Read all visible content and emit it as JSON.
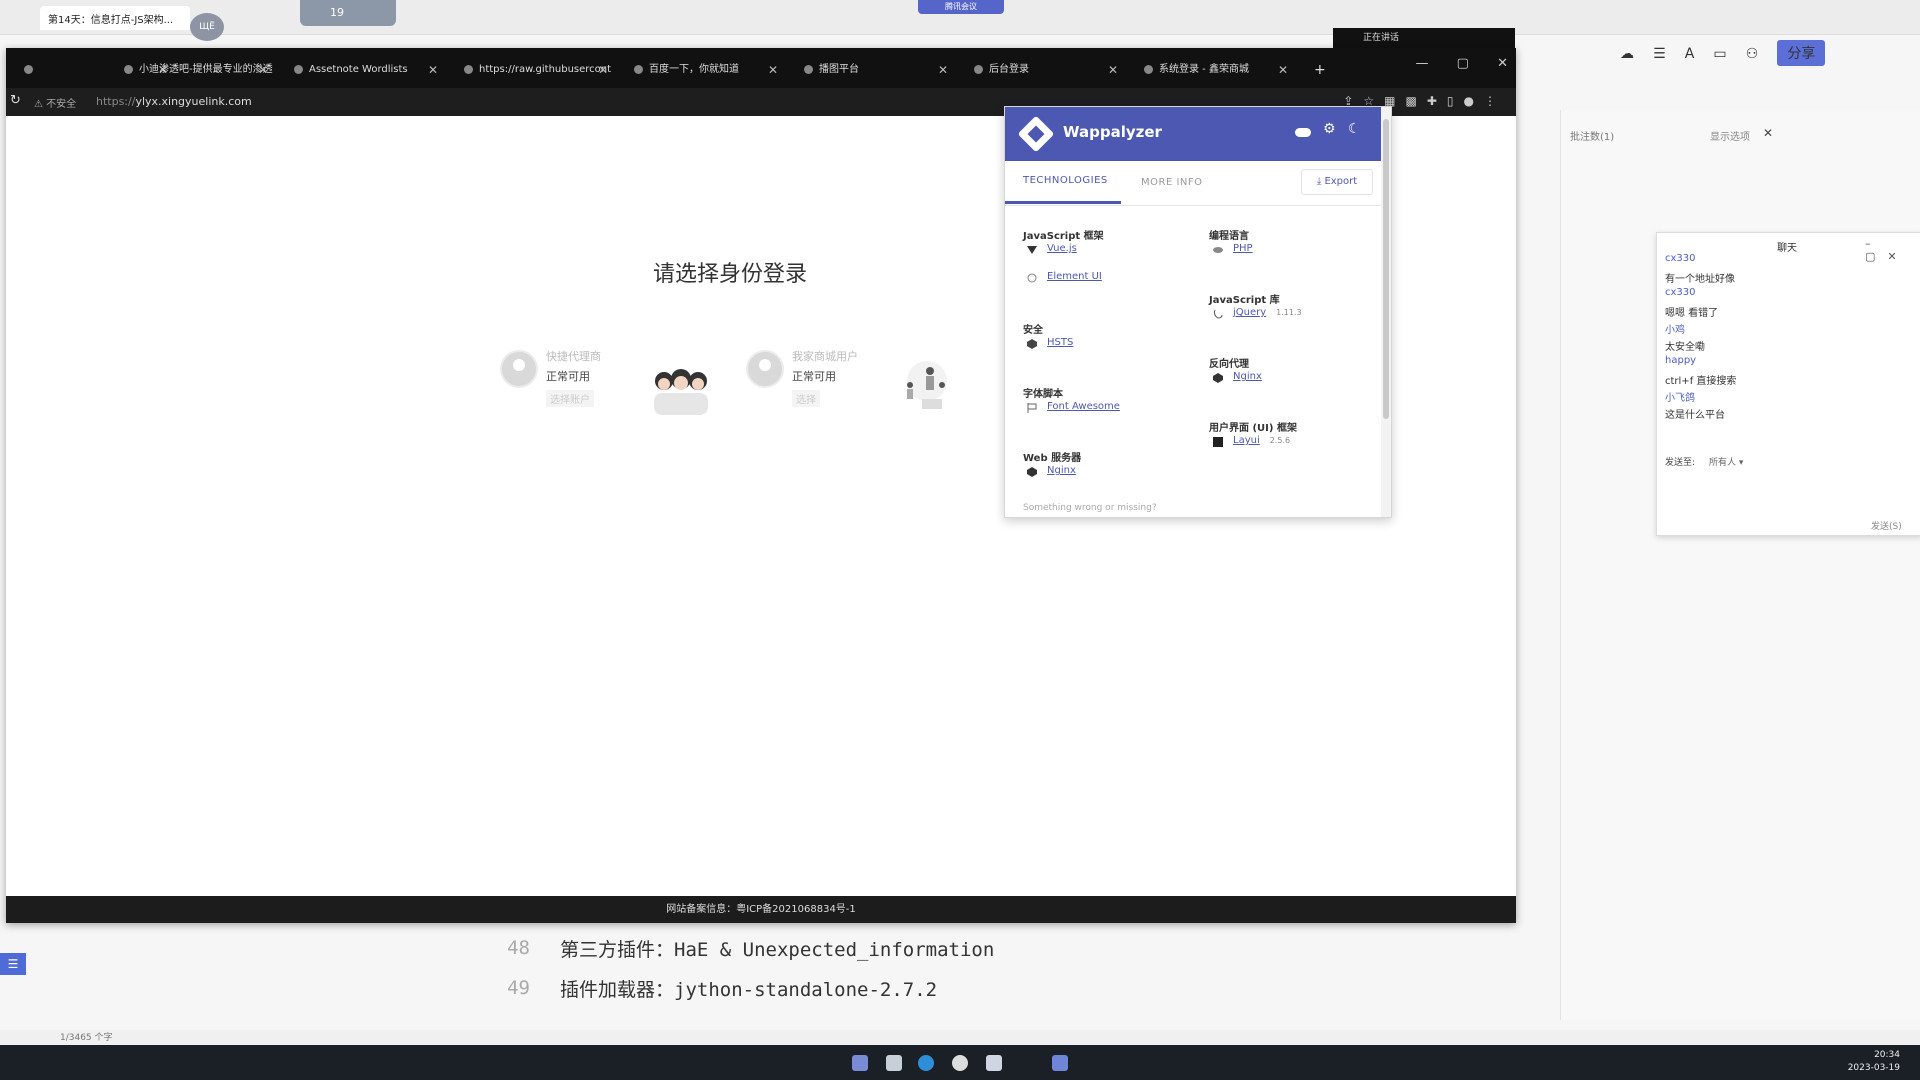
{
  "meeting": {
    "bar_label": "腾讯会议",
    "speaking_label": "正在讲话",
    "video_thumb": "19"
  },
  "editor": {
    "tab_title": "第14天：信息打点-JS架构...",
    "share_label": "分享",
    "lines": [
      {
        "no": "48",
        "text": "第三方插件：HaE & Unexpected_information"
      },
      {
        "no": "49",
        "text": "插件加载器：jython-standalone-2.7.2"
      }
    ],
    "status_text": "1/3465 个字"
  },
  "browser": {
    "tabs": [
      {
        "label": ""
      },
      {
        "label": "小迪渗透吧-提供最专业的渗透"
      },
      {
        "label": "Assetnote Wordlists"
      },
      {
        "label": "https://raw.githubusercont"
      },
      {
        "label": "百度一下，你就知道"
      },
      {
        "label": "播图平台"
      },
      {
        "label": "后台登录"
      },
      {
        "label": "系统登录 - 鑫荣商城"
      }
    ],
    "new_tab": "+",
    "insecure_label": "不安全",
    "url_scheme": "https://",
    "url_host": "ylyx.xingyuelink.com"
  },
  "page": {
    "title": "请选择身份登录",
    "roles": [
      {
        "name": "快捷代理商",
        "status": "正常可用",
        "hint": "选择账户"
      },
      {
        "name": "我家商城用户",
        "status": "正常可用",
        "hint": "选择"
      }
    ],
    "footer": "网站备案信息：粤ICP备2021068834号-1"
  },
  "wappalyzer": {
    "title": "Wappalyzer",
    "tabs": {
      "technologies": "TECHNOLOGIES",
      "more_info": "MORE INFO"
    },
    "export": "Export",
    "left_col": [
      {
        "category": "JavaScript 框架",
        "items": [
          {
            "name": "Vue.js",
            "version": ""
          },
          {
            "name": "Element UI",
            "version": ""
          }
        ]
      },
      {
        "category": "安全",
        "items": [
          {
            "name": "HSTS",
            "version": ""
          }
        ]
      },
      {
        "category": "字体脚本",
        "items": [
          {
            "name": "Font Awesome",
            "version": ""
          }
        ]
      },
      {
        "category": "Web 服务器",
        "items": [
          {
            "name": "Nginx",
            "version": ""
          }
        ]
      }
    ],
    "right_col": [
      {
        "category": "编程语言",
        "items": [
          {
            "name": "PHP",
            "version": ""
          }
        ]
      },
      {
        "category": "JavaScript 库",
        "items": [
          {
            "name": "jQuery",
            "version": "1.11.3"
          }
        ]
      },
      {
        "category": "反向代理",
        "items": [
          {
            "name": "Nginx",
            "version": ""
          }
        ]
      },
      {
        "category": "用户界面 (UI) 框架",
        "items": [
          {
            "name": "Layui",
            "version": "2.5.6"
          }
        ]
      }
    ],
    "footer": "Something wrong or missing?"
  },
  "chat": {
    "title": "聊天",
    "messages": [
      {
        "text": "cx330",
        "color": "#4b5cc4"
      },
      {
        "text": "有一个地址好像",
        "color": "#333333"
      },
      {
        "text": "cx330",
        "color": "#4b5cc4"
      },
      {
        "text": "嗯嗯 看错了",
        "color": "#333333"
      },
      {
        "text": "小鸡",
        "color": "#4b5cc4"
      },
      {
        "text": "太安全嘞",
        "color": "#333333"
      },
      {
        "text": "happy",
        "color": "#4b5cc4"
      },
      {
        "text": "ctrl+f 直接搜索",
        "color": "#333333"
      },
      {
        "text": "小飞鸽",
        "color": "#4b5cc4"
      },
      {
        "text": "这是什么平台",
        "color": "#333333"
      }
    ],
    "send_to_label": "发送至:",
    "send_target": "所有人",
    "send_button": "发送(S)"
  },
  "right_panel": {
    "search_placeholder": "批注数(1)",
    "filter_label": "显示选项"
  },
  "taskbar": {
    "time": "20:34",
    "date": "2023-03-19"
  },
  "colors": {
    "wappalyzer_accent": "#4d58b3",
    "chat_name": "#4b5cc4",
    "taskbar": "#1b1f26",
    "browser_chrome": "#111111"
  }
}
